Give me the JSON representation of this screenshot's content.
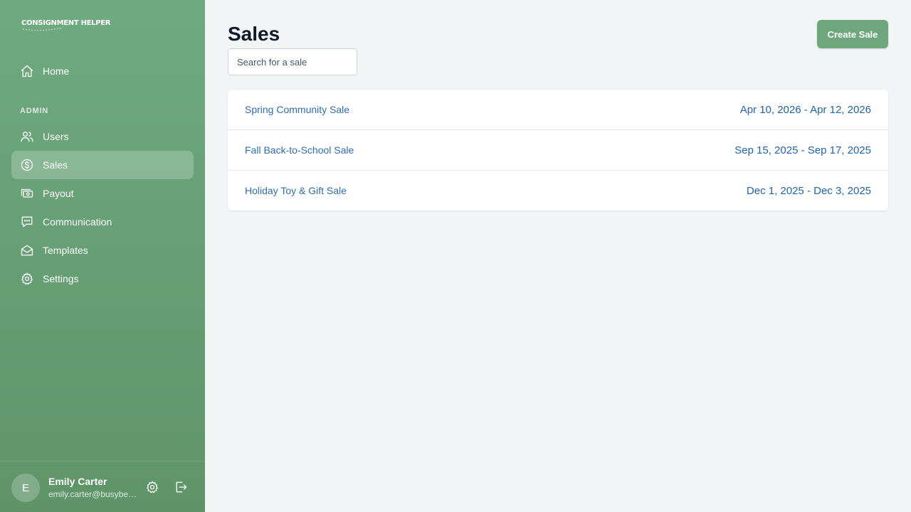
{
  "brand": {
    "logo_text": "CONSIGNMENT HELPER"
  },
  "sidebar": {
    "primary_items": [
      {
        "label": "Home",
        "icon": "home-icon"
      }
    ],
    "section_label": "ADMIN",
    "admin_items": [
      {
        "label": "Users",
        "icon": "users-icon"
      },
      {
        "label": "Sales",
        "icon": "dollar-circle-icon",
        "active": true
      },
      {
        "label": "Payout",
        "icon": "cash-icon"
      },
      {
        "label": "Communication",
        "icon": "chat-icon"
      },
      {
        "label": "Templates",
        "icon": "envelope-open-icon"
      },
      {
        "label": "Settings",
        "icon": "gear-icon"
      }
    ]
  },
  "user": {
    "initial": "E",
    "name": "Emily Carter",
    "email": "emily.carter@busybee.com"
  },
  "main": {
    "title": "Sales",
    "search_placeholder": "Search for a sale",
    "create_label": "Create Sale",
    "sales": [
      {
        "name": "Spring Community Sale",
        "dates": "Apr 10, 2026 - Apr 12, 2026"
      },
      {
        "name": "Fall Back-to-School Sale",
        "dates": "Sep 15, 2025 - Sep 17, 2025"
      },
      {
        "name": "Holiday Toy & Gift Sale",
        "dates": "Dec 1, 2025 - Dec 3, 2025"
      }
    ]
  },
  "colors": {
    "sidebar_top": "#6faa80",
    "sidebar_bottom": "#5f9468",
    "accent": "#6fa77d",
    "link": "#2f6db5",
    "page_bg": "#f3f4f6"
  }
}
